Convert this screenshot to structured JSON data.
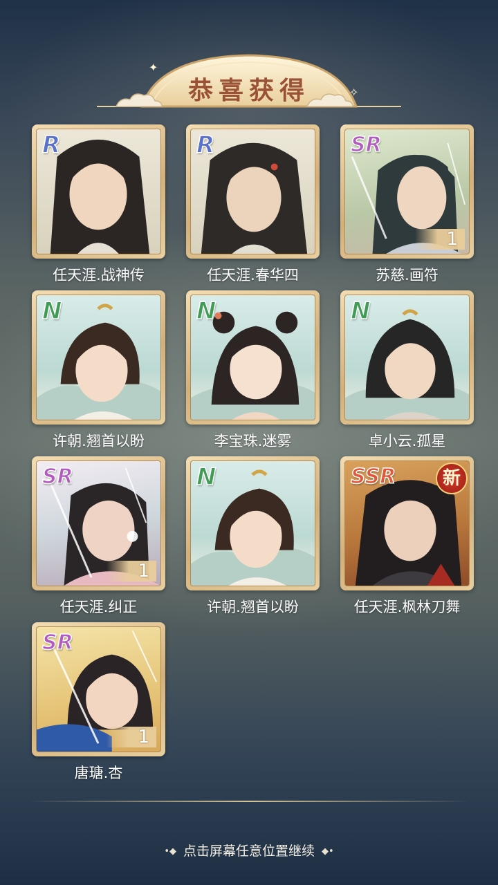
{
  "banner": {
    "title": "恭喜获得"
  },
  "cards": [
    {
      "rarity": "R",
      "name": "任天涯.战神传",
      "count": "",
      "new_badge": ""
    },
    {
      "rarity": "R",
      "name": "任天涯.春华四",
      "count": "",
      "new_badge": ""
    },
    {
      "rarity": "SR",
      "name": "苏慈.画符",
      "count": "1",
      "new_badge": ""
    },
    {
      "rarity": "N",
      "name": "许朝.翘首以盼",
      "count": "",
      "new_badge": ""
    },
    {
      "rarity": "N",
      "name": "李宝珠.迷雾",
      "count": "",
      "new_badge": ""
    },
    {
      "rarity": "N",
      "name": "卓小云.孤星",
      "count": "",
      "new_badge": ""
    },
    {
      "rarity": "SR",
      "name": "任天涯.纠正",
      "count": "1",
      "new_badge": ""
    },
    {
      "rarity": "N",
      "name": "许朝.翘首以盼",
      "count": "",
      "new_badge": ""
    },
    {
      "rarity": "SSR",
      "name": "任天涯.枫林刀舞",
      "count": "",
      "new_badge": "新"
    },
    {
      "rarity": "SR",
      "name": "唐瑭.杏",
      "count": "1",
      "new_badge": ""
    }
  ],
  "footer": {
    "continue_text": "点击屏幕任意位置继续"
  },
  "colors": {
    "R": "#5a72c9",
    "SR": "#b25bbf",
    "N": "#3e9c55",
    "SSR": "#e0583a",
    "title": "#9a5236",
    "frame": "#e3c590"
  }
}
